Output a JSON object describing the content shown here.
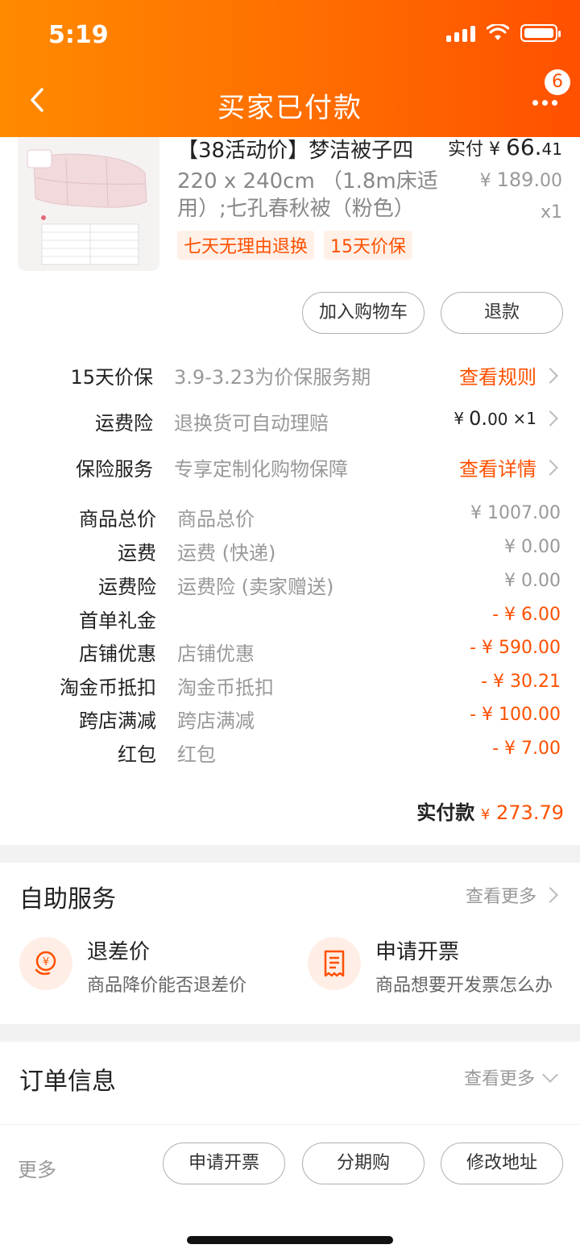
{
  "status_bar": {
    "time": "5:19"
  },
  "header": {
    "title": "买家已付款",
    "badge": "6"
  },
  "product": {
    "title": "【38活动价】梦洁被子四",
    "subtitle": "220 x 240cm （1.8m床适用）;七孔春秋被（粉色）",
    "tags": [
      "七天无理由退换",
      "15天价保"
    ],
    "paid_label": "实付",
    "paid_currency": "¥",
    "paid_int": "66.",
    "paid_dec": "41",
    "orig_currency": "¥",
    "orig_int": "189.",
    "orig_dec": "00",
    "qty": "x1"
  },
  "actions": {
    "add_cart": "加入购物车",
    "refund": "退款"
  },
  "services": [
    {
      "label": "15天价保",
      "desc": "3.9-3.23为价保服务期",
      "right": "查看规则"
    },
    {
      "label": "运费险",
      "desc": "退换货可自动理赔",
      "right_prefix": "¥",
      "right_int": "0.",
      "right_dec": "00",
      "right_qty": "×1"
    },
    {
      "label": "保险服务",
      "desc": "专享定制化购物保障",
      "right": "查看详情"
    }
  ],
  "costs": [
    {
      "label": "商品总价",
      "desc": "商品总价",
      "value": "¥ 1007.00"
    },
    {
      "label": "运费",
      "desc": "运费 (快递)",
      "value": "¥ 0.00"
    },
    {
      "label": "运费险",
      "desc": "运费险 (卖家赠送)",
      "value": "¥ 0.00"
    },
    {
      "label": "首单礼金",
      "desc": "",
      "value": "- ¥ 6.00"
    },
    {
      "label": "店铺优惠",
      "desc": "店铺优惠",
      "value": "- ¥ 590.00"
    },
    {
      "label": "淘金币抵扣",
      "desc": "淘金币抵扣",
      "value": "- ¥ 30.21"
    },
    {
      "label": "跨店满减",
      "desc": "跨店满减",
      "value": "- ¥ 100.00"
    },
    {
      "label": "红包",
      "desc": "红包",
      "value": "- ¥ 7.00"
    }
  ],
  "total": {
    "label": "实付款",
    "currency": "¥",
    "amount": "273.79"
  },
  "self_service": {
    "title": "自助服务",
    "see_more": "查看更多",
    "items": [
      {
        "title": "退差价",
        "desc": "商品降价能否退差价",
        "icon": "price-refund-icon"
      },
      {
        "title": "申请开票",
        "desc": "商品想要开发票怎么办",
        "icon": "invoice-icon"
      }
    ]
  },
  "order_info": {
    "title": "订单信息",
    "see_more": "查看更多"
  },
  "bottom_bar": {
    "more": "更多",
    "buttons": [
      "申请开票",
      "分期购",
      "修改地址"
    ]
  },
  "colors": {
    "accent": "#ff5000",
    "header_start": "#ff8a00",
    "header_end": "#ff5000"
  }
}
